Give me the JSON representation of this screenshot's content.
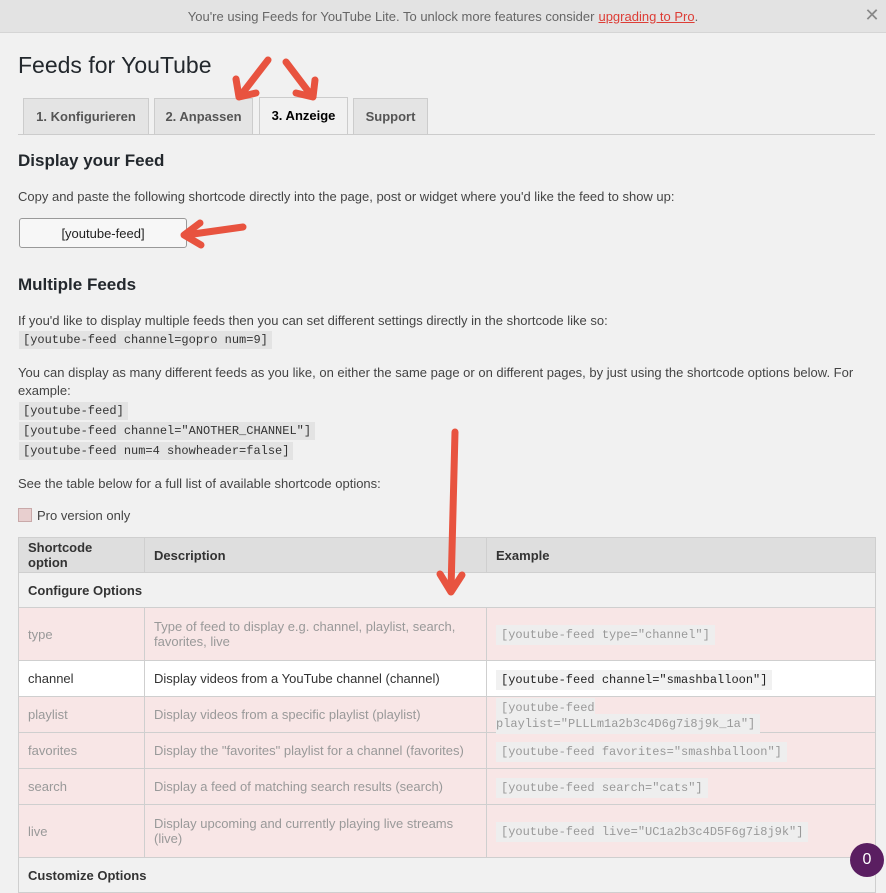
{
  "notice": {
    "text": "You're using Feeds for YouTube Lite. To unlock more features consider",
    "link": "upgrading to Pro",
    "trail": "."
  },
  "page_title": "Feeds for YouTube",
  "tabs": [
    {
      "label": "1. Konfigurieren",
      "active": false
    },
    {
      "label": "2. Anpassen",
      "active": false
    },
    {
      "label": "3. Anzeige",
      "active": true
    },
    {
      "label": "Support",
      "active": false
    }
  ],
  "display": {
    "heading": "Display your Feed",
    "intro": "Copy and paste the following shortcode directly into the page, post or widget where you'd like the feed to show up:",
    "shortcode": "[youtube-feed]"
  },
  "multiple": {
    "heading": "Multiple Feeds",
    "intro": "If you'd like to display multiple feeds then you can set different settings directly in the shortcode like so:",
    "example1": "[youtube-feed channel=gopro num=9]",
    "para2": "You can display as many different feeds as you like, on either the same page or on different pages, by just using the shortcode options below. For example:",
    "example2": "[youtube-feed]",
    "example3": "[youtube-feed channel=\"ANOTHER_CHANNEL\"]",
    "example4": "[youtube-feed num=4 showheader=false]",
    "table_intro": "See the table below for a full list of available shortcode options:",
    "legend": "Pro version only"
  },
  "table": {
    "headers": [
      "Shortcode option",
      "Description",
      "Example"
    ],
    "section1": "Configure Options",
    "rows": [
      {
        "option": "type",
        "desc": "Type of feed to display e.g. channel, playlist, search, favorites, live",
        "example": "[youtube-feed type=\"channel\"]",
        "pro": true
      },
      {
        "option": "channel",
        "desc": "Display videos from a YouTube channel (channel)",
        "example": "[youtube-feed channel=\"smashballoon\"]",
        "pro": false
      },
      {
        "option": "playlist",
        "desc": "Display videos from a specific playlist (playlist)",
        "example": "[youtube-feed playlist=\"PLLLm1a2b3c4D6g7i8j9k_1a\"]",
        "pro": true
      },
      {
        "option": "favorites",
        "desc": "Display the \"favorites\" playlist for a channel (favorites)",
        "example": "[youtube-feed favorites=\"smashballoon\"]",
        "pro": true
      },
      {
        "option": "search",
        "desc": "Display a feed of matching search results (search)",
        "example": "[youtube-feed search=\"cats\"]",
        "pro": true
      },
      {
        "option": "live",
        "desc": "Display upcoming and currently playing live streams (live)",
        "example": "[youtube-feed live=\"UC1a2b3c4D5F6g7i8j9k\"]",
        "pro": true
      }
    ],
    "section2": "Customize Options"
  },
  "badge_count": "0",
  "colors": {
    "pro_row_bg": "#f8e6e6",
    "arrow": "#e8533f",
    "badge": "#5a1e61",
    "link": "#dd3d36"
  }
}
